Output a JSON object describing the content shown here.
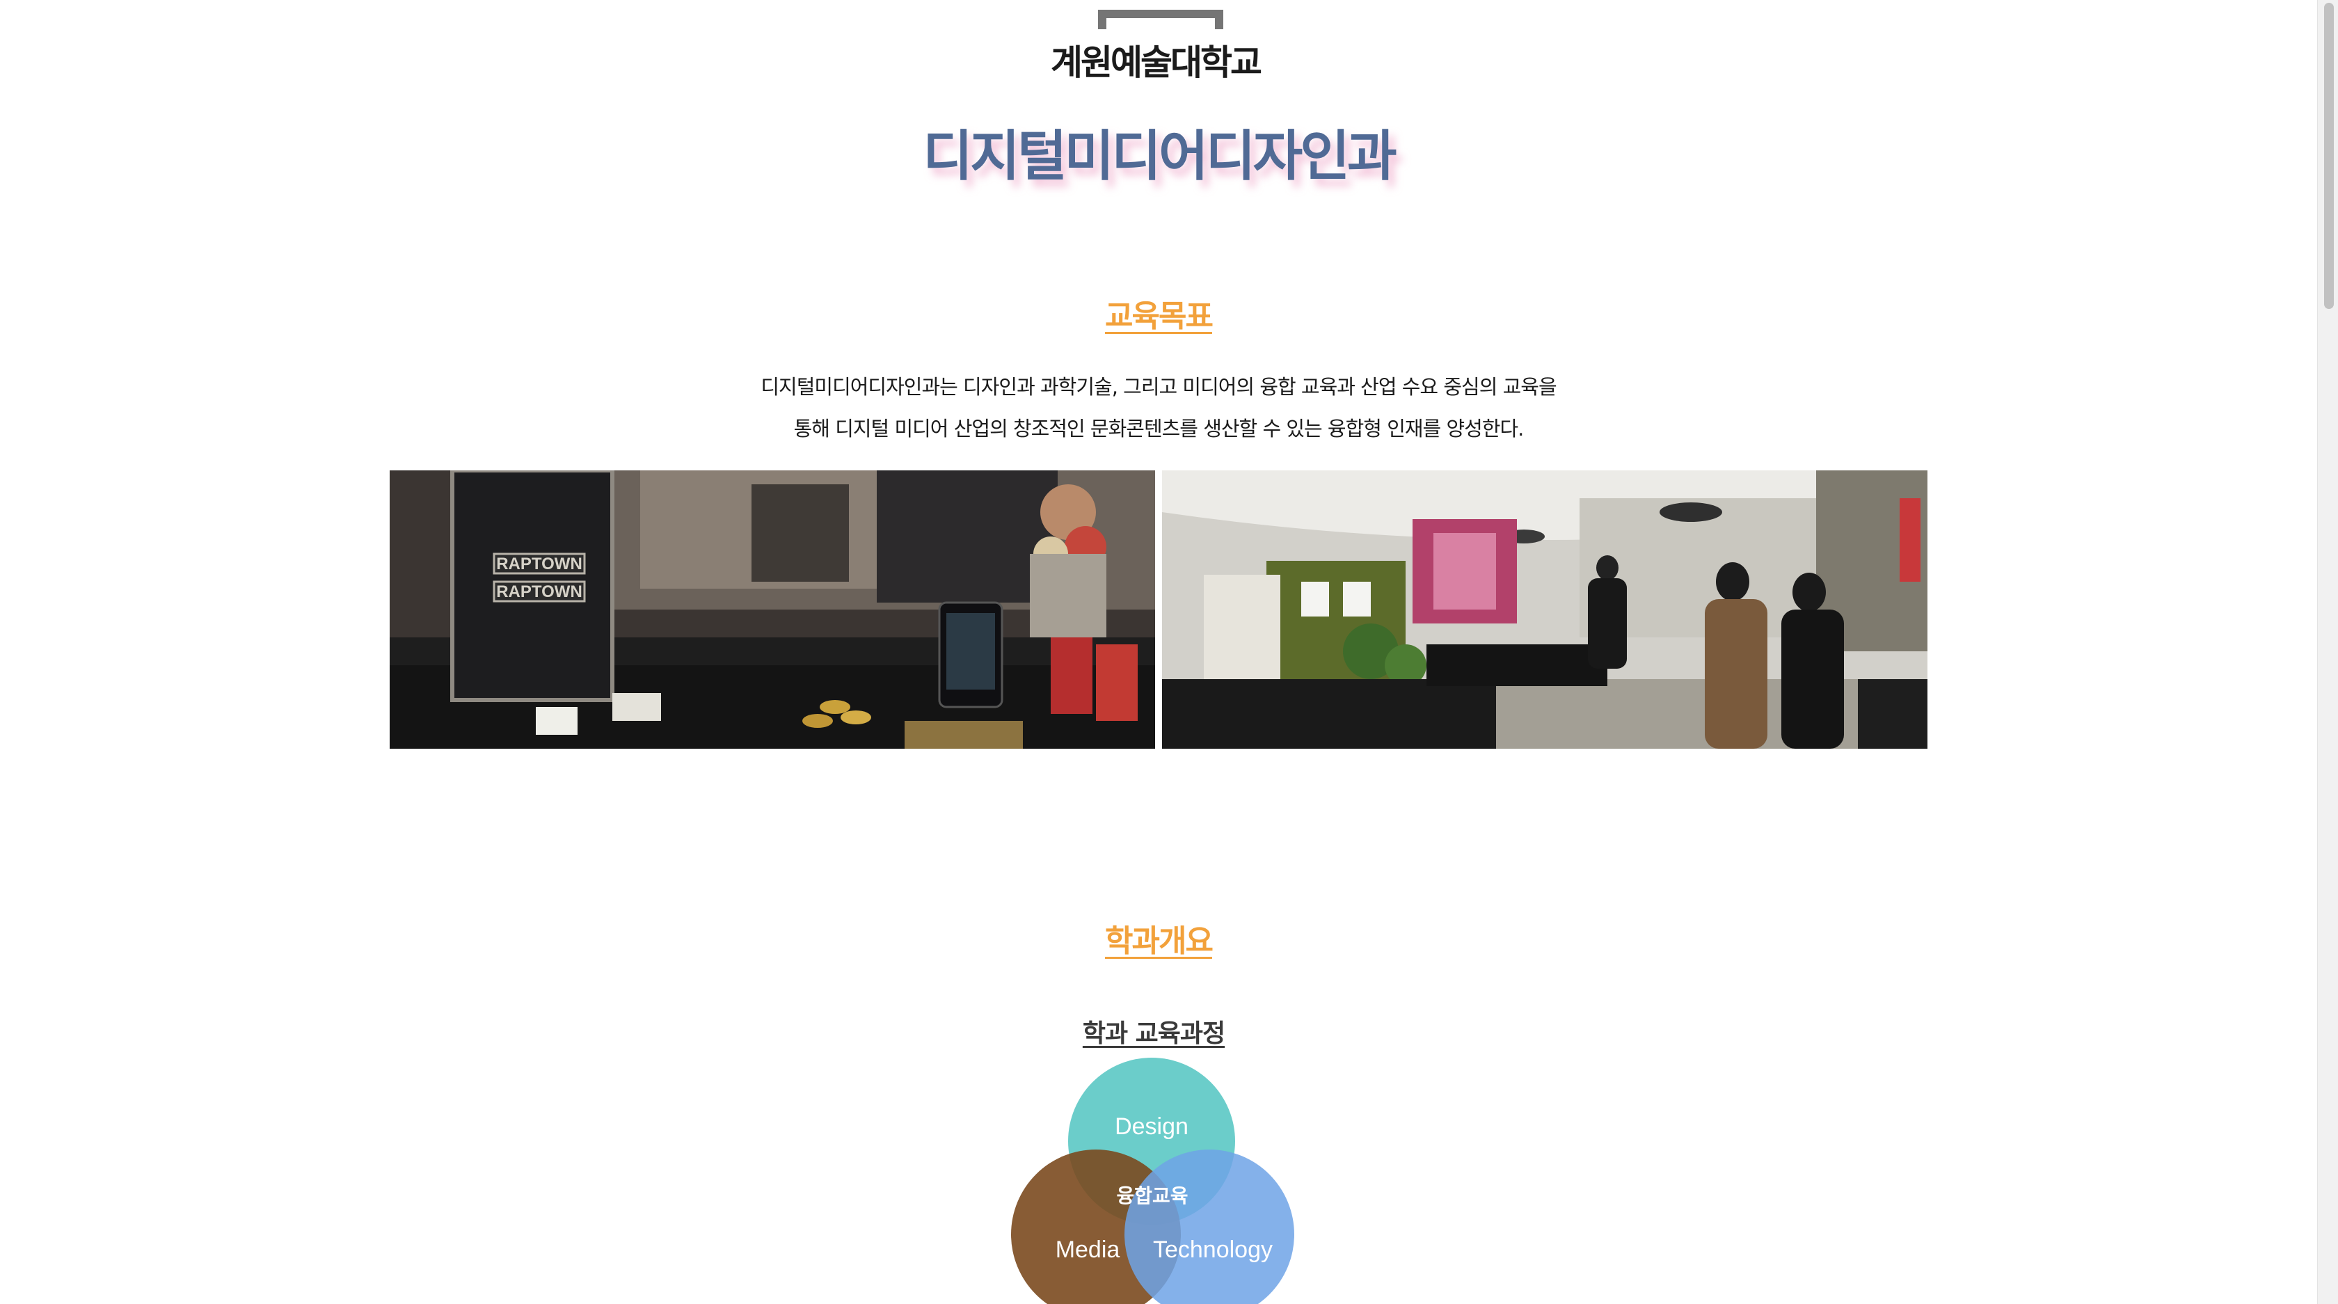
{
  "school": {
    "logo_text": "계원예술대학교"
  },
  "department": {
    "title": "디지털미디어디자인과"
  },
  "sections": {
    "goal": {
      "heading": "교육목표",
      "lines": [
        "디지털미디어디자인과는 디자인과 과학기술, 그리고 미디어의 융합 교육과 산업 수요 중심의 교육을",
        "통해 디지털 미디어 산업의 창조적인 문화콘텐츠를 생산할 수 있는 융합형 인재를 양성한다."
      ],
      "photos": {
        "left_text_1": "RAPTOWN",
        "left_text_2": "RAPTOWN"
      }
    },
    "overview": {
      "heading": "학과개요",
      "curriculum_title": "학과 교육과정",
      "venn": {
        "design": "Design",
        "media": "Media",
        "technology": "Technology",
        "center": "융합교육"
      }
    }
  },
  "colors": {
    "title_blue": "#506a95",
    "heading_orange": "#f2a13b",
    "venn_design": "#5ec9c6",
    "venn_media": "#7b4a1f",
    "venn_technology": "#6ea3e6"
  }
}
